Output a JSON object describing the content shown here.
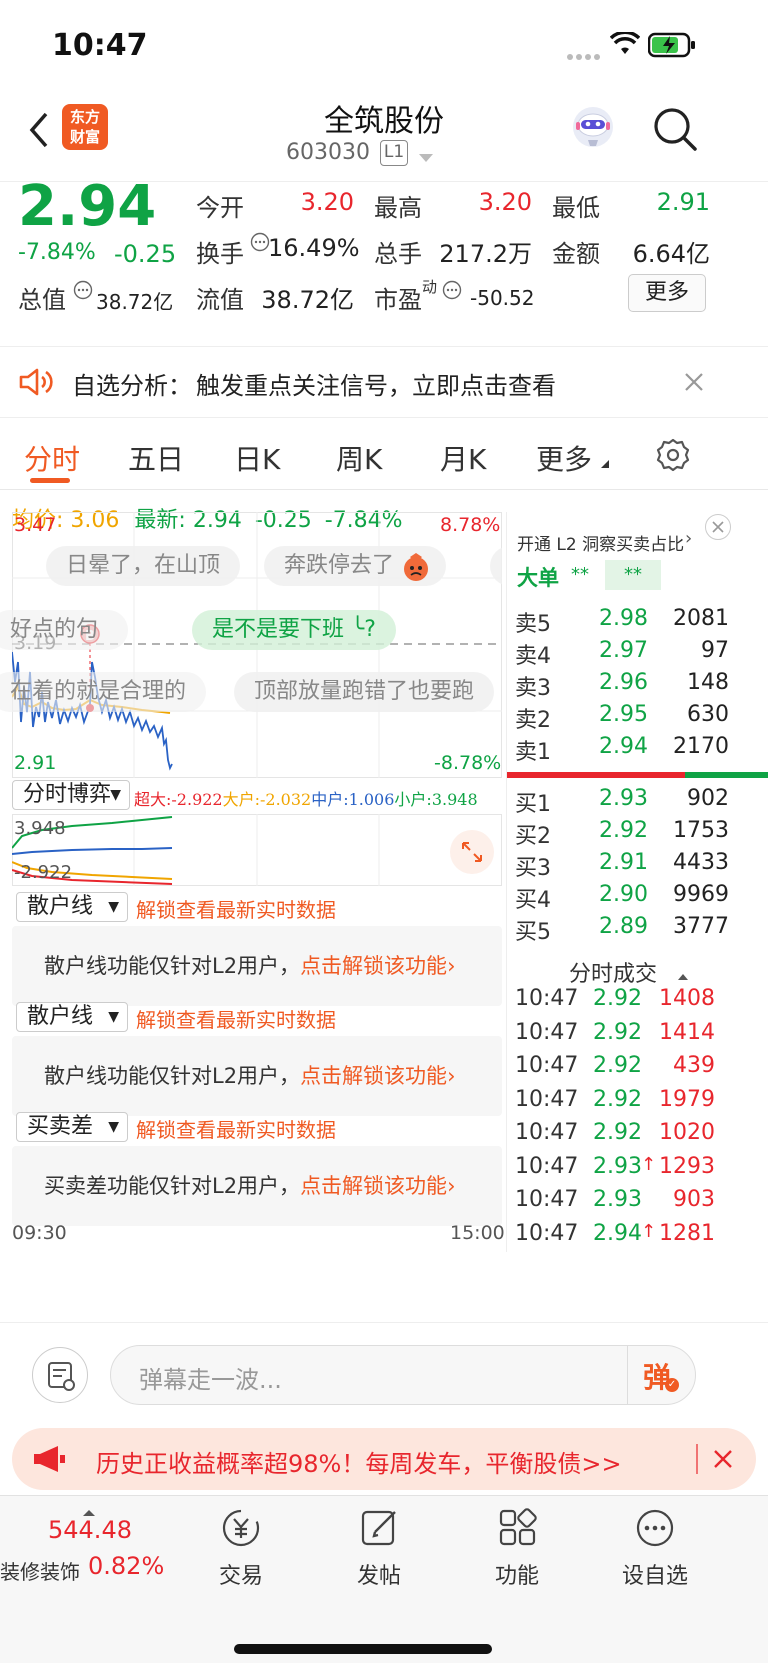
{
  "status": {
    "time": "10:47"
  },
  "nav": {
    "title": "全筑股份",
    "code": "603030",
    "level": "L1",
    "logo_line1": "东方",
    "logo_line2": "财富"
  },
  "quote": {
    "price": "2.94",
    "pct": "-7.84%",
    "chg": "-0.25",
    "open_l": "今开",
    "open_v": "3.20",
    "high_l": "最高",
    "high_v": "3.20",
    "low_l": "最低",
    "low_v": "2.91",
    "turnover_l": "换手",
    "turnover_v": "16.49%",
    "vol_l": "总手",
    "vol_v": "217.2万",
    "amt_l": "金额",
    "amt_v": "6.64亿",
    "mcap_l": "总值",
    "mcap_v": "38.72亿",
    "float_l": "流值",
    "float_v": "38.72亿",
    "pe_l": "市盈",
    "pe_sup": "动",
    "pe_v": "-50.52",
    "more": "更多"
  },
  "alert": {
    "label": "自选分析：",
    "text": "触发重点关注信号，立即点击查看"
  },
  "tabs": [
    "分时",
    "五日",
    "日K",
    "周K",
    "月K",
    "更多"
  ],
  "avgline": {
    "avg_l": "均价:",
    "avg_v": "3.06",
    "last_l": "最新:",
    "last_v": "2.94",
    "chg": "-0.25",
    "pct": "-7.84%"
  },
  "chart": {
    "ymax": "3.47",
    "ymid": "3.19",
    "ymin": "2.91",
    "pmax": "8.78%",
    "pmin": "-8.78%",
    "xstart": "09:30",
    "xend": "15:00",
    "marker": "B"
  },
  "danmu": [
    "日晕了，在山顶",
    "奔跌停去了",
    "好点的句",
    "是不是要下班",
    "?",
    "在着的就是合理的",
    "顶部放量跑错了也要跑"
  ],
  "flow": {
    "select": "分时博弈",
    "super": "超大:-2.922",
    "big": "大户:-2.032",
    "mid": "中户:1.006",
    "small": "小户:3.948",
    "top": "3.948",
    "bottom": "-2.922"
  },
  "panels": [
    {
      "select": "散户线",
      "unlock": "解锁查看最新实时数据",
      "msg": "散户线功能仅针对L2用户，",
      "cta": "点击解锁该功能"
    },
    {
      "select": "散户线",
      "unlock": "解锁查看最新实时数据",
      "msg": "散户线功能仅针对L2用户，",
      "cta": "点击解锁该功能"
    },
    {
      "select": "买卖差",
      "unlock": "解锁查看最新实时数据",
      "msg": "买卖差功能仅针对L2用户，",
      "cta": "点击解锁该功能"
    }
  ],
  "l2": {
    "banner": "开通 L2 洞察买卖占比",
    "big_l": "大单",
    "big_v1": "**",
    "big_v2": "**"
  },
  "asks": [
    {
      "l": "卖5",
      "p": "2.98",
      "v": "2081"
    },
    {
      "l": "卖4",
      "p": "2.97",
      "v": "97"
    },
    {
      "l": "卖3",
      "p": "2.96",
      "v": "148"
    },
    {
      "l": "卖2",
      "p": "2.95",
      "v": "630"
    },
    {
      "l": "卖1",
      "p": "2.94",
      "v": "2170"
    }
  ],
  "bids": [
    {
      "l": "买1",
      "p": "2.93",
      "v": "902"
    },
    {
      "l": "买2",
      "p": "2.92",
      "v": "1753"
    },
    {
      "l": "买3",
      "p": "2.91",
      "v": "4433"
    },
    {
      "l": "买4",
      "p": "2.90",
      "v": "9969"
    },
    {
      "l": "买5",
      "p": "2.89",
      "v": "3777"
    }
  ],
  "trades_title": "分时成交",
  "trades": [
    {
      "t": "10:47",
      "p": "2.92",
      "v": "1408",
      "up": ""
    },
    {
      "t": "10:47",
      "p": "2.92",
      "v": "1414",
      "up": ""
    },
    {
      "t": "10:47",
      "p": "2.92",
      "v": "439",
      "up": ""
    },
    {
      "t": "10:47",
      "p": "2.92",
      "v": "1979",
      "up": ""
    },
    {
      "t": "10:47",
      "p": "2.92",
      "v": "1020",
      "up": ""
    },
    {
      "t": "10:47",
      "p": "2.93",
      "v": "1293",
      "up": "↑"
    },
    {
      "t": "10:47",
      "p": "2.93",
      "v": "903",
      "up": ""
    },
    {
      "t": "10:47",
      "p": "2.94",
      "v": "1281",
      "up": "↑"
    }
  ],
  "comment": {
    "placeholder": "弹幕走一波...",
    "btn": "弹"
  },
  "promo": {
    "text": "历史正收益概率超98%！每周发车，平衡股债>>"
  },
  "bottom": {
    "idx_v": "544.48",
    "idx_name": "装修装饰",
    "idx_pct": "0.82%",
    "trade": "交易",
    "post": "发帖",
    "func": "功能",
    "watch": "设自选"
  },
  "colors": {
    "up": "#e8262d",
    "down": "#0fa345",
    "accent": "#f05a23"
  }
}
